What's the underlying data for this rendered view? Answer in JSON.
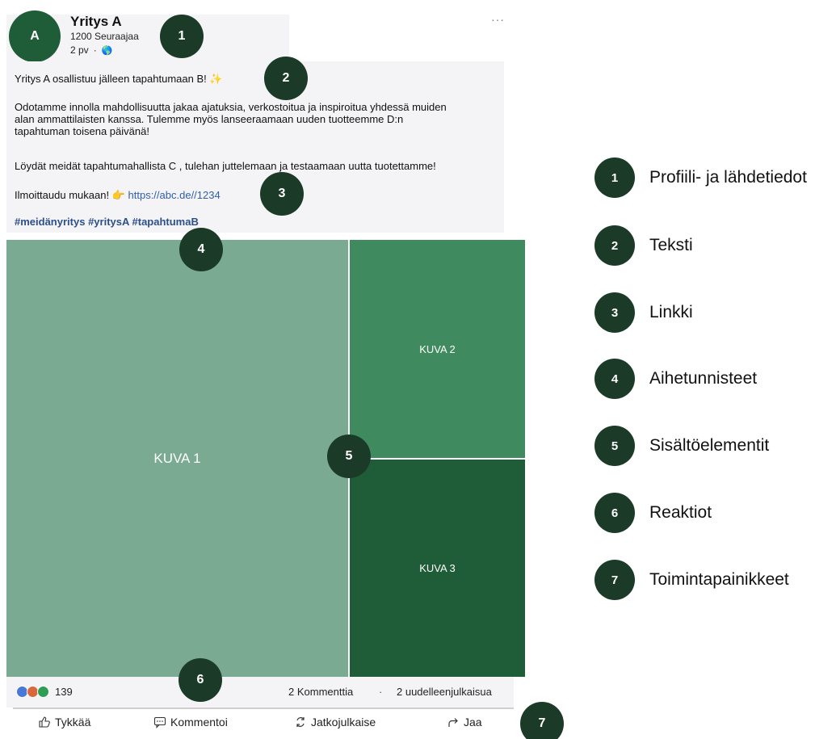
{
  "post": {
    "avatar_letter": "A",
    "company_name": "Yritys A",
    "followers": "1200 Seuraajaa",
    "posted_ago": "2 pv",
    "meta_separator": "·",
    "visibility_icon": "globe-icon",
    "more_menu": "···"
  },
  "body": {
    "line1_text": "Yritys A osallistuu jälleen tapahtumaan B!",
    "line1_emoji": "✨",
    "para2_line1": "Odotamme innolla mahdollisuutta jakaa ajatuksia, verkostoitua ja inspiroitua yhdessä muiden",
    "para2_line2": "alan ammattilaisten kanssa. Tulemme myös lanseeraamaan uuden tuotteemme D:n",
    "para2_line3": "tapahtuman toisena päivänä!",
    "para3": "Löydät meidät tapahtumahallista C , tulehan juttelemaan ja testaamaan uutta tuotettamme!",
    "signup_text": "Ilmoittaudu mukaan!",
    "signup_emoji": "👉",
    "link_url": "https://abc.de//1234",
    "hashtags": [
      "#meidänyritys",
      "#yritysA",
      "#tapahtumaB"
    ]
  },
  "images": {
    "tile1": "KUVA 1",
    "tile2": "KUVA 2",
    "tile3": "KUVA 3"
  },
  "reactions": {
    "count": "139",
    "comments": "2 Kommenttia",
    "separator": "·",
    "reposts": "2 uudelleenjulkaisua",
    "icon_colors": [
      "#4a78d9",
      "#d9683c",
      "#2e9e54"
    ]
  },
  "actions": {
    "like": "Tykkää",
    "comment": "Kommentoi",
    "repost": "Jatkojulkaise",
    "share": "Jaa"
  },
  "badges": [
    "1",
    "2",
    "3",
    "4",
    "5",
    "6",
    "7"
  ],
  "legend": [
    {
      "num": "1",
      "label": "Profiili- ja lähdetiedot"
    },
    {
      "num": "2",
      "label": "Teksti"
    },
    {
      "num": "3",
      "label": "Linkki"
    },
    {
      "num": "4",
      "label": "Aihetunnisteet"
    },
    {
      "num": "5",
      "label": "Sisältöelementit"
    },
    {
      "num": "6",
      "label": "Reaktiot"
    },
    {
      "num": "7",
      "label": "Toimintapainikkeet"
    }
  ],
  "colors": {
    "badge": "#1b3a28",
    "tile1": "#7aaa92",
    "tile2": "#3f8a5f",
    "tile3": "#1f5c38",
    "link": "#2f5fa8",
    "hashtag": "#2c4f8a"
  }
}
